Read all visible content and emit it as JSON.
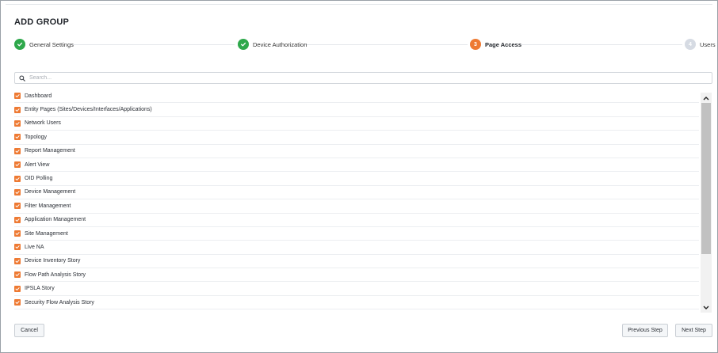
{
  "dialog": {
    "title": "ADD GROUP"
  },
  "stepper": {
    "steps": [
      {
        "number": "1",
        "label": "General Settings",
        "state": "done"
      },
      {
        "number": "2",
        "label": "Device Authorization",
        "state": "done"
      },
      {
        "number": "3",
        "label": "Page Access",
        "state": "active"
      },
      {
        "number": "4",
        "label": "Users",
        "state": "todo"
      }
    ]
  },
  "search": {
    "placeholder": "Search..."
  },
  "pages": {
    "items": [
      {
        "label": "Dashboard",
        "checked": true
      },
      {
        "label": "Entity Pages (Sites/Devices/Interfaces/Applications)",
        "checked": true
      },
      {
        "label": "Network Users",
        "checked": true
      },
      {
        "label": "Topology",
        "checked": true
      },
      {
        "label": "Report Management",
        "checked": true
      },
      {
        "label": "Alert View",
        "checked": true
      },
      {
        "label": "OID Polling",
        "checked": true
      },
      {
        "label": "Device Management",
        "checked": true
      },
      {
        "label": "Filter Management",
        "checked": true
      },
      {
        "label": "Application Management",
        "checked": true
      },
      {
        "label": "Site Management",
        "checked": true
      },
      {
        "label": "Live NA",
        "checked": true
      },
      {
        "label": "Device Inventory Story",
        "checked": true
      },
      {
        "label": "Flow Path Analysis Story",
        "checked": true
      },
      {
        "label": "IPSLA Story",
        "checked": true
      },
      {
        "label": "Security Flow Analysis Story",
        "checked": true
      }
    ]
  },
  "footer": {
    "cancel_label": "Cancel",
    "previous_label": "Previous Step",
    "next_label": "Next Step"
  },
  "colors": {
    "done": "#2ea84b",
    "active": "#ee7a33",
    "todo": "#d6dbe3",
    "checkbox": "#ee7a33"
  },
  "icons": {
    "done_step": "check-icon",
    "search": "search-icon",
    "checkbox": "checkmark-icon",
    "scroll_up": "chevron-up-icon",
    "scroll_down": "chevron-down-icon"
  }
}
